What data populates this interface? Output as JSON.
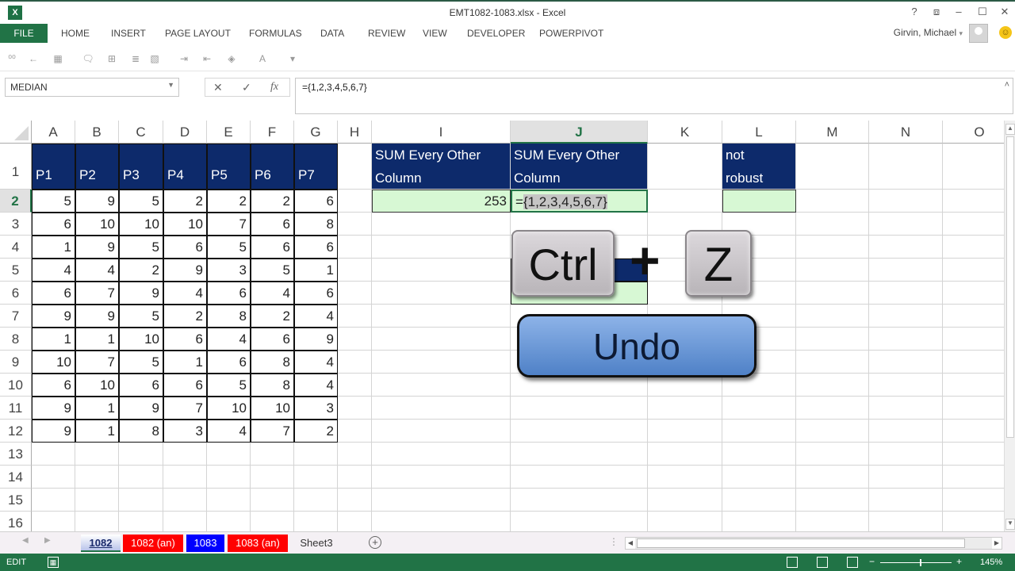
{
  "window": {
    "title": "EMT1082-1083.xlsx - Excel",
    "app_icon": "excel-logo-icon",
    "controls": [
      "help-icon",
      "ribbon-display-icon",
      "minimize-icon",
      "maximize-icon",
      "close-icon"
    ],
    "control_glyphs": [
      "?",
      "⧈",
      "–",
      "☐",
      "✕"
    ]
  },
  "ribbon": {
    "tabs": [
      "FILE",
      "HOME",
      "INSERT",
      "PAGE LAYOUT",
      "FORMULAS",
      "DATA",
      "REVIEW",
      "VIEW",
      "DEVELOPER",
      "POWERPIVOT"
    ],
    "user_name": "Girvin, Michael",
    "user_dropdown": "▾"
  },
  "quick_toolbar": {
    "icons": [
      {
        "name": "increase-decimal-icon",
        "glyph": "⁰⁰"
      },
      {
        "name": "decrease-decimal-icon",
        "glyph": "←"
      },
      {
        "name": "format-table-icon",
        "glyph": "▦"
      },
      {
        "name": "comment-icon",
        "glyph": "🗨"
      },
      {
        "name": "borders-icon",
        "glyph": "⊞"
      },
      {
        "name": "wrap-text-icon",
        "glyph": "≣"
      },
      {
        "name": "format-painter-icon",
        "glyph": "▧"
      },
      {
        "name": "indent-increase-icon",
        "glyph": "⇥"
      },
      {
        "name": "indent-decrease-icon",
        "glyph": "⇤"
      },
      {
        "name": "fill-color-icon",
        "glyph": "◈"
      },
      {
        "name": "font-color-icon",
        "glyph": "A"
      },
      {
        "name": "customize-toolbar-icon",
        "glyph": "▾"
      }
    ]
  },
  "formula_bar": {
    "name_box": "MEDIAN",
    "cancel_glyph": "✕",
    "enter_glyph": "✓",
    "fx_glyph": "fx",
    "formula": "={1,2,3,4,5,6,7}",
    "collapse_glyph": "˄"
  },
  "columns": [
    "A",
    "B",
    "C",
    "D",
    "E",
    "F",
    "G",
    "H",
    "I",
    "J",
    "K",
    "L",
    "M",
    "N",
    "O"
  ],
  "selected_column": "J",
  "rows": [
    "1",
    "2",
    "3",
    "4",
    "5",
    "6",
    "7",
    "8",
    "9",
    "10",
    "11",
    "12",
    "13",
    "14",
    "15",
    "16"
  ],
  "selected_row": "2",
  "table": {
    "headers": [
      "P1",
      "P2",
      "P3",
      "P4",
      "P5",
      "P6",
      "P7"
    ],
    "values": [
      [
        5,
        9,
        5,
        2,
        2,
        2,
        6
      ],
      [
        6,
        10,
        10,
        10,
        7,
        6,
        8
      ],
      [
        1,
        9,
        5,
        6,
        5,
        6,
        6
      ],
      [
        4,
        4,
        2,
        9,
        3,
        5,
        1
      ],
      [
        6,
        7,
        9,
        4,
        6,
        4,
        6
      ],
      [
        9,
        9,
        5,
        2,
        8,
        2,
        4
      ],
      [
        1,
        1,
        10,
        6,
        4,
        6,
        9
      ],
      [
        10,
        7,
        5,
        1,
        6,
        8,
        4
      ],
      [
        6,
        10,
        6,
        6,
        5,
        8,
        4
      ],
      [
        9,
        1,
        9,
        7,
        10,
        10,
        3
      ],
      [
        9,
        1,
        8,
        3,
        4,
        7,
        2
      ]
    ]
  },
  "side_cells": {
    "I1": [
      "SUM Every Other",
      "Column"
    ],
    "I2": "253",
    "J1": [
      "SUM Every Other",
      "Column"
    ],
    "J2_prefix": "=",
    "J2_selected": "{1,2,3,4,5,6,7}",
    "L1": [
      "not",
      "robust"
    ],
    "L2": ""
  },
  "overlay": {
    "key1": "Ctrl",
    "plus": "+",
    "key2": "Z",
    "action": "Undo"
  },
  "sheet_tabs": [
    {
      "label": "1082",
      "active": true,
      "color": "#c9d4f0",
      "text_color": "#1a2a6b"
    },
    {
      "label": "1082 (an)",
      "active": false,
      "color": "#ff0000",
      "text_color": "#ffffff"
    },
    {
      "label": "1083",
      "active": false,
      "color": "#0000ff",
      "text_color": "#ffffff"
    },
    {
      "label": "1083 (an)",
      "active": false,
      "color": "#ff0000",
      "text_color": "#ffffff"
    },
    {
      "label": "Sheet3",
      "active": false,
      "color": "#f4f0f4",
      "text_color": "#333333"
    }
  ],
  "add_sheet_glyph": "+",
  "status": {
    "mode": "EDIT",
    "zoom": "145%",
    "views": [
      "normal-view-icon",
      "page-layout-view-icon",
      "page-break-view-icon"
    ]
  },
  "colors": {
    "excel_green": "#217346",
    "header_fill": "#0d2a6b",
    "result_fill": "#d7f8d4"
  }
}
